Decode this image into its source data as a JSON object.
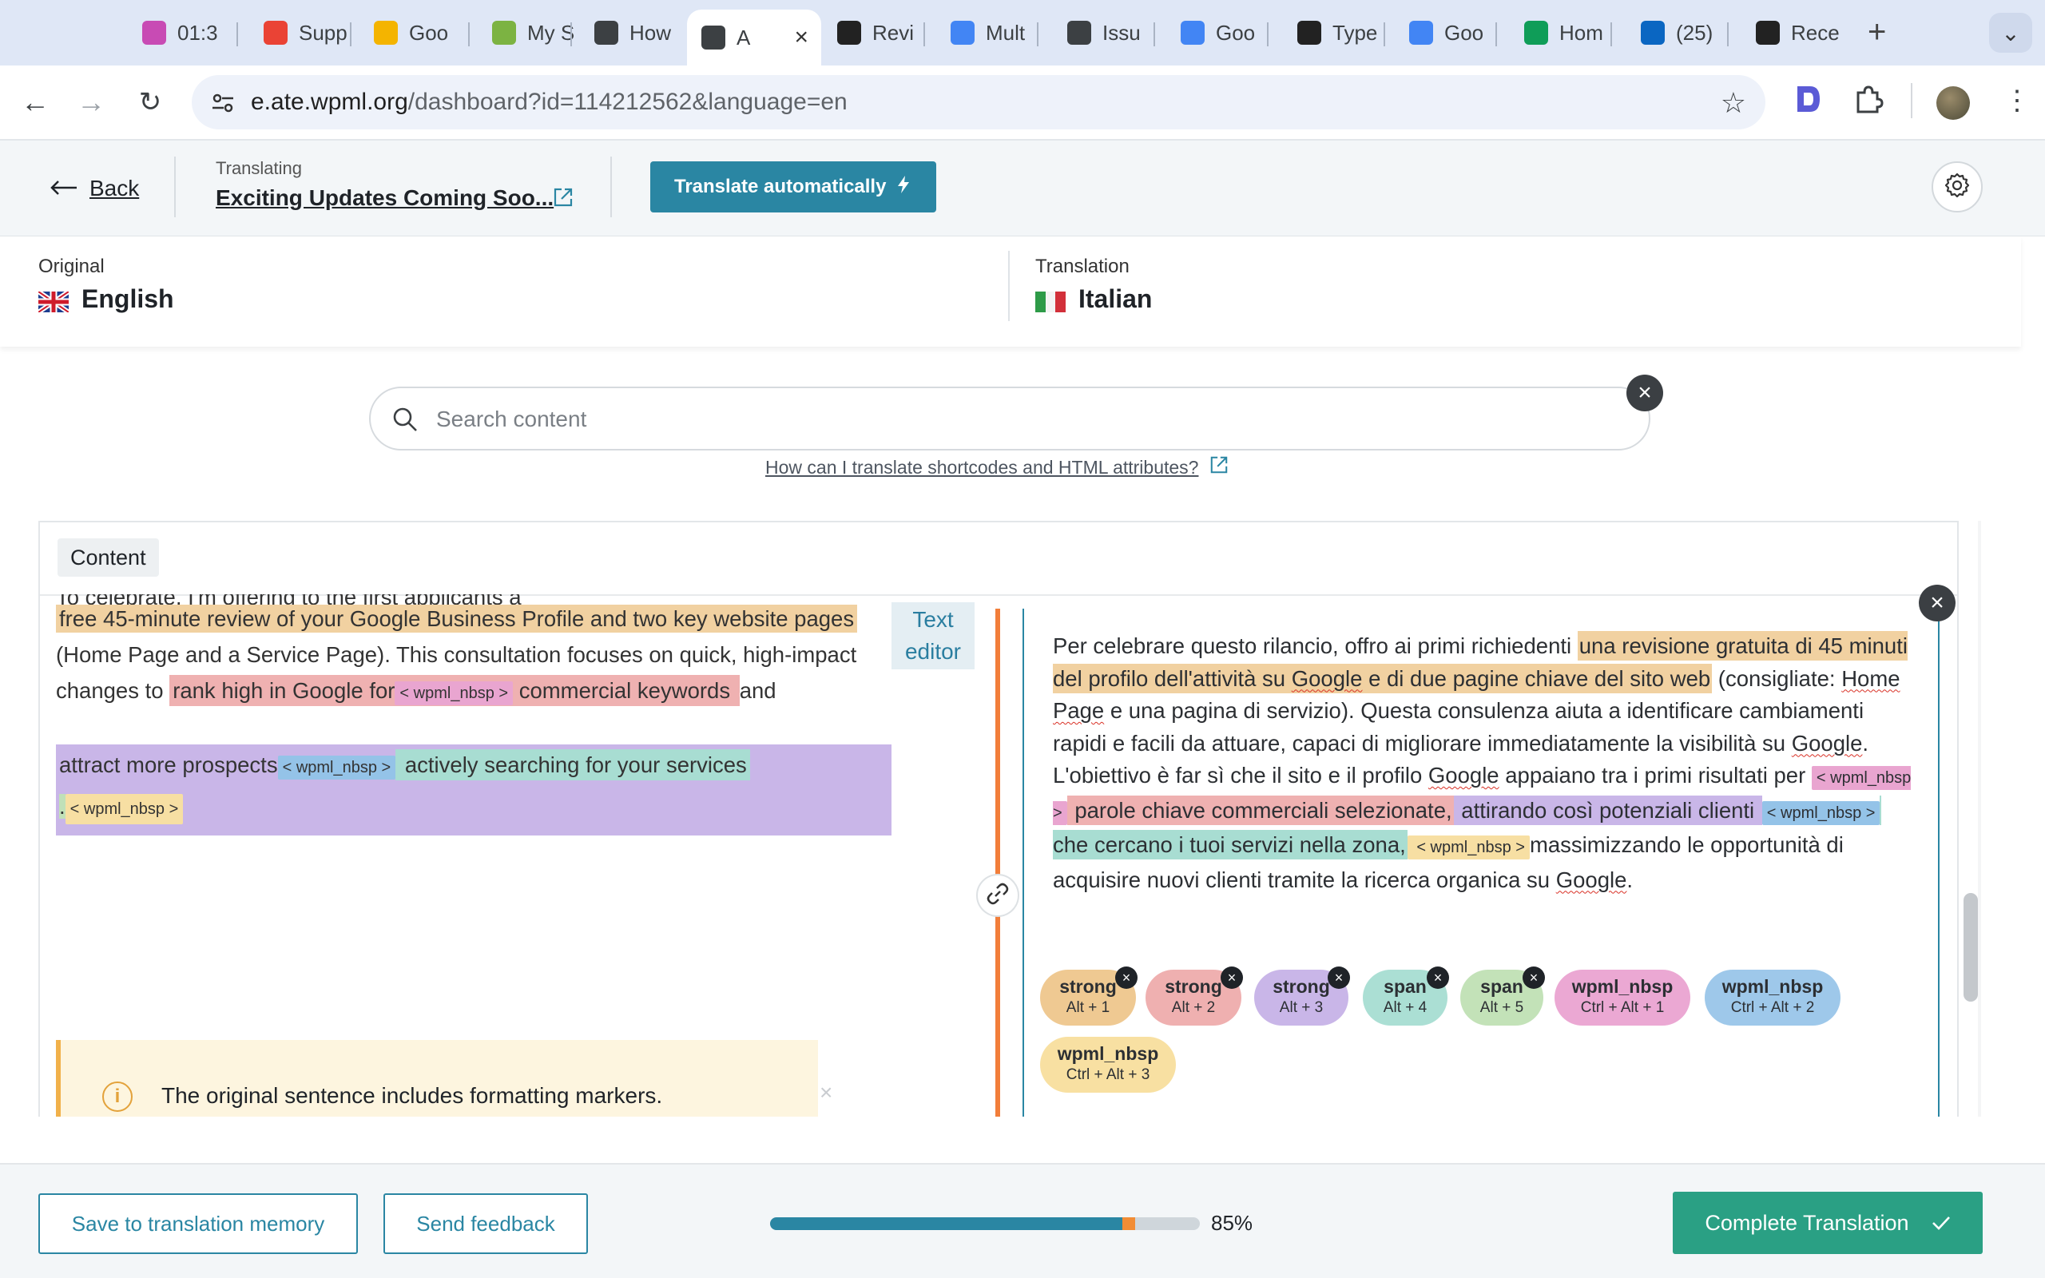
{
  "browser": {
    "tabs": [
      {
        "title": "01:3",
        "icon": "timer-icon",
        "color": "#c84bb4"
      },
      {
        "title": "Supp",
        "icon": "gmail-icon",
        "color": "#ea4335"
      },
      {
        "title": "Goo",
        "icon": "keep-icon",
        "color": "#f4b400"
      },
      {
        "title": "My S",
        "icon": "target-icon",
        "color": "#7cb342"
      },
      {
        "title": "How",
        "icon": "loading-icon",
        "color": "#3c4043"
      },
      {
        "title": "A",
        "icon": "loading-icon",
        "color": "#3c4043"
      },
      {
        "title": "Revi",
        "icon": "openai-icon",
        "color": "#222222"
      },
      {
        "title": "Mult",
        "icon": "docs-icon",
        "color": "#4285f4"
      },
      {
        "title": "Issu",
        "icon": "loading-icon",
        "color": "#3c4043"
      },
      {
        "title": "Goo",
        "icon": "calendar-icon",
        "color": "#4285f4"
      },
      {
        "title": "Type",
        "icon": "typeform-icon",
        "color": "#222222"
      },
      {
        "title": "Goo",
        "icon": "calendar-icon",
        "color": "#4285f4"
      },
      {
        "title": "Hom",
        "icon": "drive-icon",
        "color": "#0f9d58"
      },
      {
        "title": "(25)",
        "icon": "linkedin-icon",
        "color": "#0a66c2"
      },
      {
        "title": "Rece",
        "icon": "s-icon",
        "color": "#222222"
      }
    ],
    "active_tab_index": 5,
    "url_host": "e.ate.wpml.org",
    "url_path": "/dashboard?id=114212562&language=en"
  },
  "header": {
    "back_label": "Back",
    "translating_label": "Translating",
    "document_title": "Exciting Updates Coming Soo...",
    "auto_translate_label": "Translate automatically"
  },
  "languages": {
    "original_label": "Original",
    "original_name": "English",
    "translation_label": "Translation",
    "translation_name": "Italian"
  },
  "search": {
    "placeholder": "Search content",
    "help_link": "How can I translate shortcodes and HTML attributes?"
  },
  "content": {
    "section_label": "Content",
    "text_editor_label": "Text editor",
    "source": {
      "line0": "To celebrate, I'm offering to the first applicants a",
      "seg1": "free 45-minute review of your Google Business Profile and two key website pages",
      "seg_plain1": "(Home Page and a Service Page). This consultation focuses on quick, high-impact changes to ",
      "seg2": "rank high in Google for",
      "tag_pink": "< wpml_nbsp >",
      "seg2b": " commercial keywords ",
      "seg_and": " and",
      "seg3": "attract more prospects",
      "tag_blue": "< wpml_nbsp >",
      "seg4": " actively searching for your services",
      "seg5_dot": ".",
      "tag_yellow": "< wpml_nbsp >"
    },
    "target": {
      "t0": "Per celebrare questo rilancio, offro ai primi richiedenti ",
      "t1": "una revisione gratuita di 45 minuti del profilo dell'attività su Google e di due pagine chiave del sito web",
      "t2": " (consigliate: Home Page e una pagina di servizio). Questa consulenza aiuta a identificare cambiamenti rapidi e facili da attuare, capaci di migliorare immediatamente la visibilità su Google. L'obiettivo è far sì che il sito e il profilo Google appaiano tra i primi risultati per ",
      "tag_pink": "< wpml_nbsp >",
      "t3": " parole chiave commerciali selezionate,",
      "t4": " attirando così potenziali clienti ",
      "tag_blue": "< wpml_nbsp >",
      "t5": " che cercano i tuoi servizi nella zona,",
      "tag_yellow": " < wpml_nbsp >",
      "t6": "massimizzando le opportunità di acquisire nuovi clienti tramite la ricerca organica su Google."
    },
    "chips": [
      {
        "name": "strong",
        "keys": "Alt + 1",
        "color": "#efc992",
        "removable": true
      },
      {
        "name": "strong",
        "keys": "Alt + 2",
        "color": "#efb0b0",
        "removable": true
      },
      {
        "name": "strong",
        "keys": "Alt + 3",
        "color": "#c9b6e8",
        "removable": true
      },
      {
        "name": "span",
        "keys": "Alt + 4",
        "color": "#abdfd4",
        "removable": true
      },
      {
        "name": "span",
        "keys": "Alt + 5",
        "color": "#c3e2b8",
        "removable": true
      },
      {
        "name": "wpml_nbsp",
        "keys": "Ctrl + Alt + 1",
        "color": "#eba8d3",
        "removable": false
      },
      {
        "name": "wpml_nbsp",
        "keys": "Ctrl + Alt + 2",
        "color": "#9ec8ea",
        "removable": false
      },
      {
        "name": "wpml_nbsp",
        "keys": "Ctrl + Alt + 3",
        "color": "#f8e0a2",
        "removable": false
      }
    ],
    "notice": "The original sentence includes formatting markers."
  },
  "footer": {
    "save_tm_label": "Save to translation memory",
    "feedback_label": "Send feedback",
    "progress": 0.85,
    "progress_label": "85%",
    "complete_label": "Complete Translation"
  }
}
